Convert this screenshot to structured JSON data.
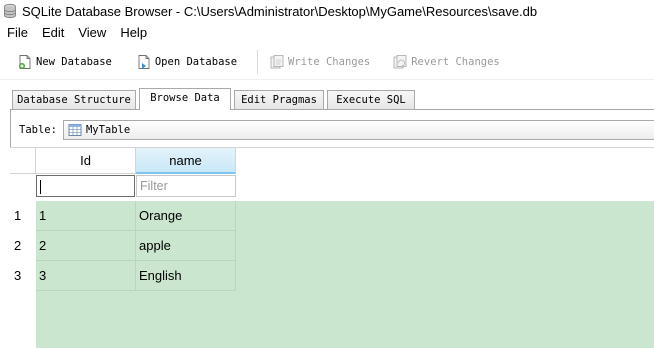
{
  "window": {
    "title": "SQLite Database Browser - C:\\Users\\Administrator\\Desktop\\MyGame\\Resources\\save.db",
    "icon": "database-icon"
  },
  "menu": [
    "File",
    "Edit",
    "View",
    "Help"
  ],
  "toolbar": {
    "new_database": "New Database",
    "open_database": "Open Database",
    "write_changes": "Write Changes",
    "revert_changes": "Revert Changes"
  },
  "tabs": [
    {
      "label": "Database Structure",
      "active": false
    },
    {
      "label": "Browse Data",
      "active": true
    },
    {
      "label": "Edit Pragmas",
      "active": false
    },
    {
      "label": "Execute SQL",
      "active": false
    }
  ],
  "browse": {
    "table_label": "Table:",
    "table_value": "MyTable",
    "columns": [
      "Id",
      "name"
    ],
    "filter_placeholder": "Filter",
    "rows": [
      {
        "num": "1",
        "id": "1",
        "name": "Orange"
      },
      {
        "num": "2",
        "id": "2",
        "name": "apple"
      },
      {
        "num": "3",
        "id": "3",
        "name": "English"
      }
    ]
  },
  "colors": {
    "data_background": "#cbe6cf",
    "selected_header": "#c9e8f7"
  }
}
